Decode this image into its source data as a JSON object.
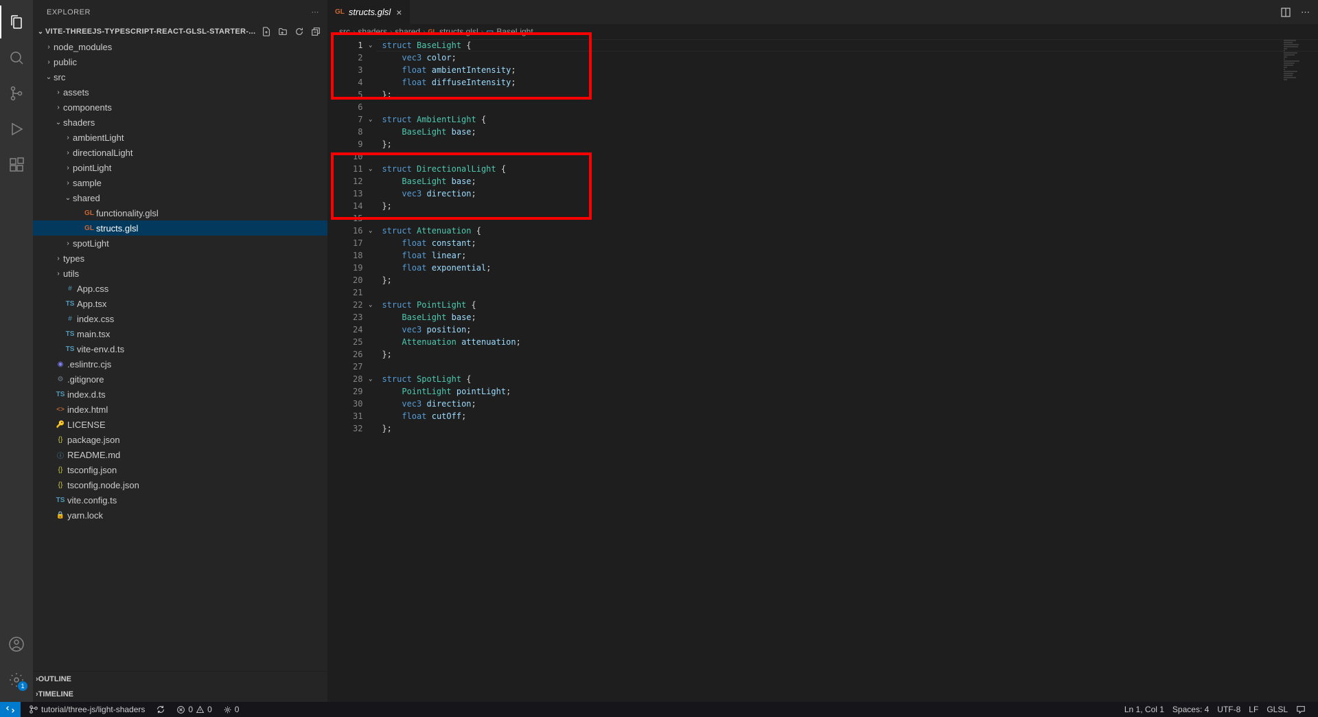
{
  "sidebar": {
    "title": "EXPLORER",
    "project_title": "VITE-THREEJS-TYPESCRIPT-REACT-GLSL-STARTER-...",
    "outline": "OUTLINE",
    "timeline": "TIMELINE"
  },
  "tree": {
    "node_modules": "node_modules",
    "public": "public",
    "src": "src",
    "assets": "assets",
    "components": "components",
    "shaders": "shaders",
    "ambientLight": "ambientLight",
    "directionalLight": "directionalLight",
    "pointLight": "pointLight",
    "sample": "sample",
    "shared": "shared",
    "functionality": "functionality.glsl",
    "structs": "structs.glsl",
    "spotLight": "spotLight",
    "types": "types",
    "utils": "utils",
    "appcss": "App.css",
    "apptsx": "App.tsx",
    "indexcss": "index.css",
    "maintsx": "main.tsx",
    "viteenv": "vite-env.d.ts",
    "eslintrc": ".eslintrc.cjs",
    "gitignore": ".gitignore",
    "indexdts": "index.d.ts",
    "indexhtml": "index.html",
    "license": "LICENSE",
    "package": "package.json",
    "readme": "README.md",
    "tsconfig": "tsconfig.json",
    "tsconfignode": "tsconfig.node.json",
    "viteconfig": "vite.config.ts",
    "yarnlock": "yarn.lock"
  },
  "tab": {
    "label": "structs.glsl"
  },
  "breadcrumbs": {
    "c0": "src",
    "c1": "shaders",
    "c2": "shared",
    "c3": "structs.glsl",
    "c4": "BaseLight"
  },
  "code": {
    "lines": [
      {
        "n": 1,
        "fold": true,
        "tokens": [
          [
            "t-struct",
            "struct "
          ],
          [
            "t-type",
            "BaseLight"
          ],
          [
            "t-punc",
            " {"
          ]
        ]
      },
      {
        "n": 2,
        "tokens": [
          [
            "",
            "    "
          ],
          [
            "t-builtin",
            "vec3"
          ],
          [
            "",
            " "
          ],
          [
            "t-ident",
            "color"
          ],
          [
            "t-punc",
            ";"
          ]
        ]
      },
      {
        "n": 3,
        "tokens": [
          [
            "",
            "    "
          ],
          [
            "t-builtin",
            "float"
          ],
          [
            "",
            " "
          ],
          [
            "t-ident",
            "ambientIntensity"
          ],
          [
            "t-punc",
            ";"
          ]
        ]
      },
      {
        "n": 4,
        "tokens": [
          [
            "",
            "    "
          ],
          [
            "t-builtin",
            "float"
          ],
          [
            "",
            " "
          ],
          [
            "t-ident",
            "diffuseIntensity"
          ],
          [
            "t-punc",
            ";"
          ]
        ]
      },
      {
        "n": 5,
        "tokens": [
          [
            "t-punc",
            "};"
          ]
        ]
      },
      {
        "n": 6,
        "tokens": [
          [
            "",
            ""
          ]
        ]
      },
      {
        "n": 7,
        "fold": true,
        "tokens": [
          [
            "t-struct",
            "struct "
          ],
          [
            "t-type",
            "AmbientLight"
          ],
          [
            "t-punc",
            " {"
          ]
        ]
      },
      {
        "n": 8,
        "tokens": [
          [
            "",
            "    "
          ],
          [
            "t-type",
            "BaseLight"
          ],
          [
            "",
            " "
          ],
          [
            "t-ident",
            "base"
          ],
          [
            "t-punc",
            ";"
          ]
        ]
      },
      {
        "n": 9,
        "tokens": [
          [
            "t-punc",
            "};"
          ]
        ]
      },
      {
        "n": 10,
        "tokens": [
          [
            "",
            ""
          ]
        ]
      },
      {
        "n": 11,
        "fold": true,
        "tokens": [
          [
            "t-struct",
            "struct "
          ],
          [
            "t-type",
            "DirectionalLight"
          ],
          [
            "t-punc",
            " {"
          ]
        ]
      },
      {
        "n": 12,
        "tokens": [
          [
            "",
            "    "
          ],
          [
            "t-type",
            "BaseLight"
          ],
          [
            "",
            " "
          ],
          [
            "t-ident",
            "base"
          ],
          [
            "t-punc",
            ";"
          ]
        ]
      },
      {
        "n": 13,
        "tokens": [
          [
            "",
            "    "
          ],
          [
            "t-builtin",
            "vec3"
          ],
          [
            "",
            " "
          ],
          [
            "t-ident",
            "direction"
          ],
          [
            "t-punc",
            ";"
          ]
        ]
      },
      {
        "n": 14,
        "tokens": [
          [
            "t-punc",
            "};"
          ]
        ]
      },
      {
        "n": 15,
        "tokens": [
          [
            "",
            ""
          ]
        ]
      },
      {
        "n": 16,
        "fold": true,
        "tokens": [
          [
            "t-struct",
            "struct "
          ],
          [
            "t-type",
            "Attenuation"
          ],
          [
            "t-punc",
            " {"
          ]
        ]
      },
      {
        "n": 17,
        "tokens": [
          [
            "",
            "    "
          ],
          [
            "t-builtin",
            "float"
          ],
          [
            "",
            " "
          ],
          [
            "t-ident",
            "constant"
          ],
          [
            "t-punc",
            ";"
          ]
        ]
      },
      {
        "n": 18,
        "tokens": [
          [
            "",
            "    "
          ],
          [
            "t-builtin",
            "float"
          ],
          [
            "",
            " "
          ],
          [
            "t-ident",
            "linear"
          ],
          [
            "t-punc",
            ";"
          ]
        ]
      },
      {
        "n": 19,
        "tokens": [
          [
            "",
            "    "
          ],
          [
            "t-builtin",
            "float"
          ],
          [
            "",
            " "
          ],
          [
            "t-ident",
            "exponential"
          ],
          [
            "t-punc",
            ";"
          ]
        ]
      },
      {
        "n": 20,
        "tokens": [
          [
            "t-punc",
            "};"
          ]
        ]
      },
      {
        "n": 21,
        "tokens": [
          [
            "",
            ""
          ]
        ]
      },
      {
        "n": 22,
        "fold": true,
        "tokens": [
          [
            "t-struct",
            "struct "
          ],
          [
            "t-type",
            "PointLight"
          ],
          [
            "t-punc",
            " {"
          ]
        ]
      },
      {
        "n": 23,
        "tokens": [
          [
            "",
            "    "
          ],
          [
            "t-type",
            "BaseLight"
          ],
          [
            "",
            " "
          ],
          [
            "t-ident",
            "base"
          ],
          [
            "t-punc",
            ";"
          ]
        ]
      },
      {
        "n": 24,
        "tokens": [
          [
            "",
            "    "
          ],
          [
            "t-builtin",
            "vec3"
          ],
          [
            "",
            " "
          ],
          [
            "t-ident",
            "position"
          ],
          [
            "t-punc",
            ";"
          ]
        ]
      },
      {
        "n": 25,
        "tokens": [
          [
            "",
            "    "
          ],
          [
            "t-type",
            "Attenuation"
          ],
          [
            "",
            " "
          ],
          [
            "t-ident",
            "attenuation"
          ],
          [
            "t-punc",
            ";"
          ]
        ]
      },
      {
        "n": 26,
        "tokens": [
          [
            "t-punc",
            "};"
          ]
        ]
      },
      {
        "n": 27,
        "tokens": [
          [
            "",
            ""
          ]
        ]
      },
      {
        "n": 28,
        "fold": true,
        "tokens": [
          [
            "t-struct",
            "struct "
          ],
          [
            "t-type",
            "SpotLight"
          ],
          [
            "t-punc",
            " {"
          ]
        ]
      },
      {
        "n": 29,
        "tokens": [
          [
            "",
            "    "
          ],
          [
            "t-type",
            "PointLight"
          ],
          [
            "",
            " "
          ],
          [
            "t-ident",
            "pointLight"
          ],
          [
            "t-punc",
            ";"
          ]
        ]
      },
      {
        "n": 30,
        "tokens": [
          [
            "",
            "    "
          ],
          [
            "t-builtin",
            "vec3"
          ],
          [
            "",
            " "
          ],
          [
            "t-ident",
            "direction"
          ],
          [
            "t-punc",
            ";"
          ]
        ]
      },
      {
        "n": 31,
        "tokens": [
          [
            "",
            "    "
          ],
          [
            "t-builtin",
            "float"
          ],
          [
            "",
            " "
          ],
          [
            "t-ident",
            "cutOff"
          ],
          [
            "t-punc",
            ";"
          ]
        ]
      },
      {
        "n": 32,
        "tokens": [
          [
            "t-punc",
            "};"
          ]
        ]
      }
    ]
  },
  "status": {
    "branch": "tutorial/three-js/light-shaders",
    "errors": "0",
    "warnings": "0",
    "ports": "0",
    "ln_col": "Ln 1, Col 1",
    "spaces": "Spaces: 4",
    "encoding": "UTF-8",
    "eol": "LF",
    "lang": "GLSL"
  },
  "settings_badge": "1"
}
